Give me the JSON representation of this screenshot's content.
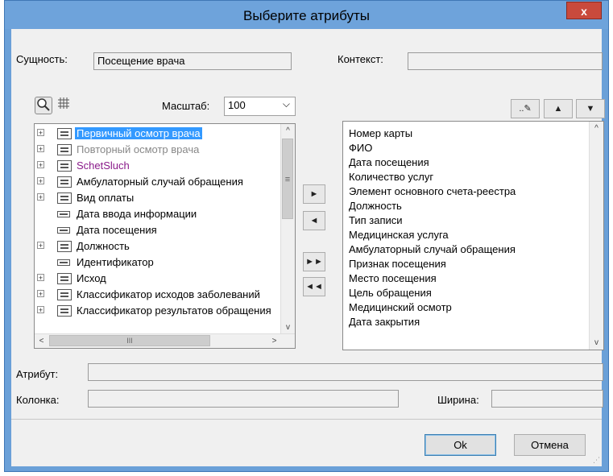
{
  "window": {
    "title": "Выберите атрибуты",
    "close_label": "x"
  },
  "entity": {
    "label": "Сущность:",
    "value": "Посещение врача"
  },
  "context": {
    "label": "Контекст:",
    "value": ""
  },
  "scale": {
    "label": "Масштаб:",
    "value": "100"
  },
  "tree": {
    "items": [
      {
        "label": "Первичный осмотр врача",
        "style": "selected",
        "icon": "folder-icon"
      },
      {
        "label": "Повторный осмотр врача",
        "style": "grey",
        "icon": "folder-icon"
      },
      {
        "label": "SchetSluch",
        "style": "purple",
        "icon": "folder-icon"
      },
      {
        "label": "Амбулаторный случай обращения",
        "style": "normal",
        "icon": "folder-icon"
      },
      {
        "label": "Вид оплаты",
        "style": "normal",
        "icon": "folder-icon"
      },
      {
        "label": "Дата ввода информации",
        "style": "leaf",
        "icon": "field-icon"
      },
      {
        "label": "Дата посещения",
        "style": "leaf",
        "icon": "field-icon"
      },
      {
        "label": "Должность",
        "style": "normal",
        "icon": "folder-icon"
      },
      {
        "label": "Идентификатор",
        "style": "leaf",
        "icon": "field-icon"
      },
      {
        "label": "Исход",
        "style": "normal",
        "icon": "folder-icon"
      },
      {
        "label": "Классификатор исходов заболеваний",
        "style": "normal",
        "icon": "folder-icon"
      },
      {
        "label": "Классификатор результатов обращения",
        "style": "normal",
        "icon": "folder-icon"
      }
    ]
  },
  "selected_list": {
    "items": [
      "Номер карты",
      "ФИО",
      "Дата посещения",
      "Количество услуг",
      "Элемент основного счета-реестра",
      "Должность",
      "Тип записи",
      "Медицинская услуга",
      "Амбулаторный случай обращения",
      "Признак посещения",
      "Место посещения",
      "Цель обращения",
      "Медицинский осмотр",
      "Дата закрытия"
    ]
  },
  "attribute": {
    "label": "Атрибут:",
    "value": ""
  },
  "column": {
    "label": "Колонка:",
    "value": ""
  },
  "width": {
    "label": "Ширина:",
    "value": ""
  },
  "buttons": {
    "ok": "Ok",
    "cancel": "Отмена"
  },
  "glyphs": {
    "add": "►",
    "remove": "◄",
    "add_all": "►►",
    "remove_all": "◄◄",
    "up": "▲",
    "down": "▼",
    "combo_arrow": "⌵",
    "scroll_up": "^",
    "scroll_down": "v",
    "scroll_left": "<",
    "scroll_right": ">",
    "scroll_grip": "≡",
    "hscroll_grip": "III",
    "edit": "..✎"
  }
}
